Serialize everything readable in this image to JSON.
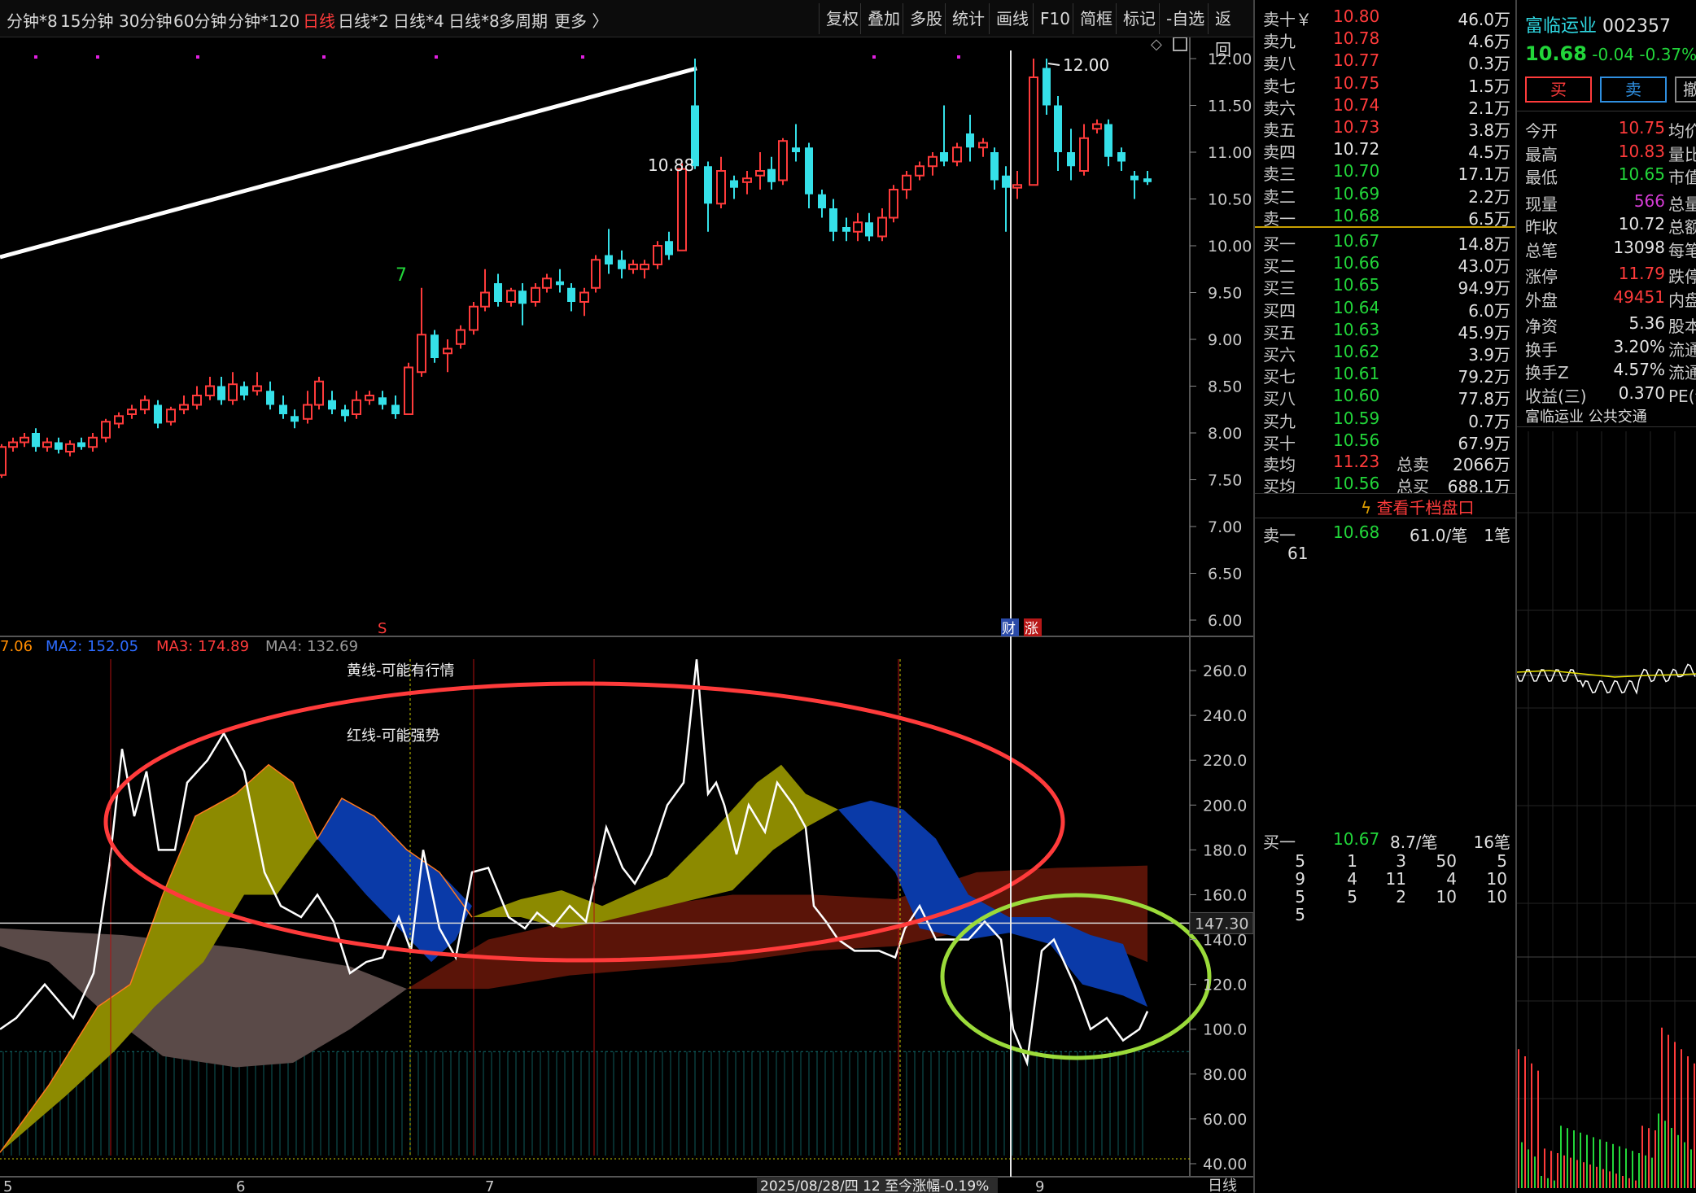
{
  "toolbar": {
    "periods": [
      "分钟*8",
      "15分钟",
      "30分钟",
      "60分钟",
      "分钟*120",
      "日线",
      "日线*2",
      "日线*4",
      "日线*8",
      "多周期",
      "更多 〉"
    ],
    "active_period": "日线",
    "buttons": [
      "复权",
      "叠加",
      "多股",
      "统计",
      "画线",
      "F10",
      "简框",
      "标记",
      "-自选",
      "返回"
    ]
  },
  "price_axis": {
    "labels": [
      "12.00",
      "11.50",
      "11.00",
      "10.50",
      "10.00",
      "9.50",
      "9.00",
      "8.50",
      "8.00",
      "7.50",
      "7.00",
      "6.50",
      "6.00"
    ]
  },
  "annotations": {
    "high_label": "10.88",
    "peak_label": "12.00",
    "marker_7": "7",
    "marker_s": "S",
    "marker_cai": "财",
    "marker_zhang": "涨"
  },
  "indicator": {
    "legend": [
      {
        "label": "7.06",
        "color": "#ff8c00"
      },
      {
        "label": "MA2: 152.05",
        "color": "#2d6cff"
      },
      {
        "label": "MA3: 174.89",
        "color": "#ff3b3b"
      },
      {
        "label": "MA4: 132.69",
        "color": "#9a9a9a"
      }
    ],
    "axis_labels": [
      "260.0",
      "240.0",
      "220.0",
      "200.0",
      "180.0",
      "160.0",
      "147.30",
      "140.0",
      "120.0",
      "100.0",
      "80.00",
      "60.00",
      "40.00"
    ],
    "note_yellow": "黄线-可能有行情",
    "note_red": "红线-可能强势"
  },
  "date_axis": {
    "ticks": [
      "5",
      "6",
      "7",
      "9"
    ],
    "crosshair_label": "2025/08/28/四 12 至今涨幅-0.19%",
    "period_label": "日线"
  },
  "orderbook": {
    "sells": [
      {
        "name": "卖十￥",
        "price": "10.80",
        "vol": "46.0万",
        "color": "red"
      },
      {
        "name": "卖九",
        "price": "10.78",
        "vol": "4.6万",
        "color": "red"
      },
      {
        "name": "卖八",
        "price": "10.77",
        "vol": "0.3万",
        "color": "red"
      },
      {
        "name": "卖七",
        "price": "10.75",
        "vol": "1.5万",
        "color": "red"
      },
      {
        "name": "卖六",
        "price": "10.74",
        "vol": "2.1万",
        "color": "red"
      },
      {
        "name": "卖五",
        "price": "10.73",
        "vol": "3.8万",
        "color": "red"
      },
      {
        "name": "卖四",
        "price": "10.72",
        "vol": "4.5万",
        "color": "white"
      },
      {
        "name": "卖三",
        "price": "10.70",
        "vol": "17.1万",
        "color": "green"
      },
      {
        "name": "卖二",
        "price": "10.69",
        "vol": "2.2万",
        "color": "green"
      },
      {
        "name": "卖一",
        "price": "10.68",
        "vol": "6.5万",
        "color": "green"
      }
    ],
    "buys": [
      {
        "name": "买一",
        "price": "10.67",
        "vol": "14.8万",
        "color": "green"
      },
      {
        "name": "买二",
        "price": "10.66",
        "vol": "43.0万",
        "color": "green"
      },
      {
        "name": "买三",
        "price": "10.65",
        "vol": "94.9万",
        "color": "green"
      },
      {
        "name": "买四",
        "price": "10.64",
        "vol": "6.0万",
        "color": "green"
      },
      {
        "name": "买五",
        "price": "10.63",
        "vol": "45.9万",
        "color": "green"
      },
      {
        "name": "买六",
        "price": "10.62",
        "vol": "3.9万",
        "color": "green"
      },
      {
        "name": "买七",
        "price": "10.61",
        "vol": "79.2万",
        "color": "green"
      },
      {
        "name": "买八",
        "price": "10.60",
        "vol": "77.8万",
        "color": "green"
      },
      {
        "name": "买九",
        "price": "10.59",
        "vol": "0.7万",
        "color": "green"
      },
      {
        "name": "买十",
        "price": "10.56",
        "vol": "67.9万",
        "color": "green"
      }
    ],
    "sell_avg": {
      "label": "卖均",
      "price": "11.23",
      "tot_label": "总卖",
      "tot": "2066万"
    },
    "buy_avg": {
      "label": "买均",
      "price": "10.56",
      "tot_label": "总买",
      "tot": "688.1万"
    },
    "thousand_link": "查看千档盘口",
    "queue_sell": {
      "label": "卖一",
      "price": "10.68",
      "per": "61.0/笔",
      "count": "1笔",
      "orders": [
        "61"
      ]
    },
    "queue_buy": {
      "label": "买一",
      "price": "10.67",
      "per": "8.7/笔",
      "count": "16笔",
      "rows": [
        [
          "5",
          "1",
          "3",
          "50",
          "5"
        ],
        [
          "9",
          "4",
          "11",
          "4",
          "10"
        ],
        [
          "5",
          "5",
          "2",
          "10",
          "10"
        ],
        [
          "5",
          "",
          "",
          "",
          ""
        ]
      ]
    }
  },
  "stock": {
    "name": "富临运业",
    "code": "002357",
    "price": "10.68",
    "change": "-0.04",
    "pct": "-0.37%",
    "buy_btn": "买",
    "sell_btn": "卖",
    "cancel_btn": "撤",
    "fields": [
      {
        "label": "今开",
        "value": "10.75",
        "color": "red",
        "right": "均价"
      },
      {
        "label": "最高",
        "value": "10.83",
        "color": "red",
        "right": "量比"
      },
      {
        "label": "最低",
        "value": "10.65",
        "color": "green",
        "right": "市值"
      },
      {
        "label": "现量",
        "value": "566",
        "color": "purple",
        "right": "总量"
      },
      {
        "label": "昨收",
        "value": "10.72",
        "color": "white",
        "right": "总额"
      },
      {
        "label": "总笔",
        "value": "13098",
        "color": "white",
        "right": "每笔"
      },
      {
        "label": "涨停",
        "value": "11.79",
        "color": "red",
        "right": "跌停"
      },
      {
        "label": "外盘",
        "value": "49451",
        "color": "red",
        "right": "内盘"
      },
      {
        "label": "净资",
        "value": "5.36",
        "color": "white",
        "right": "股本"
      },
      {
        "label": "换手",
        "value": "3.20%",
        "color": "white",
        "right": "流通"
      },
      {
        "label": "换手Z",
        "value": "4.57%",
        "color": "white",
        "right": "流通"
      },
      {
        "label": "收益(三)",
        "value": "0.370",
        "color": "white",
        "right": "PE(动"
      }
    ],
    "tags": [
      "富临运业",
      "公共交通"
    ]
  },
  "colors": {
    "up": "#ff3b3b",
    "down": "#35e0e8",
    "yellow_band": "#8c8a00",
    "blue_band": "#0a3aa8",
    "red_band": "#5a1408",
    "gray_band": "#5a4a48",
    "ellipse_red": "#ff3b3b",
    "ellipse_green": "#9bdb3a"
  }
}
